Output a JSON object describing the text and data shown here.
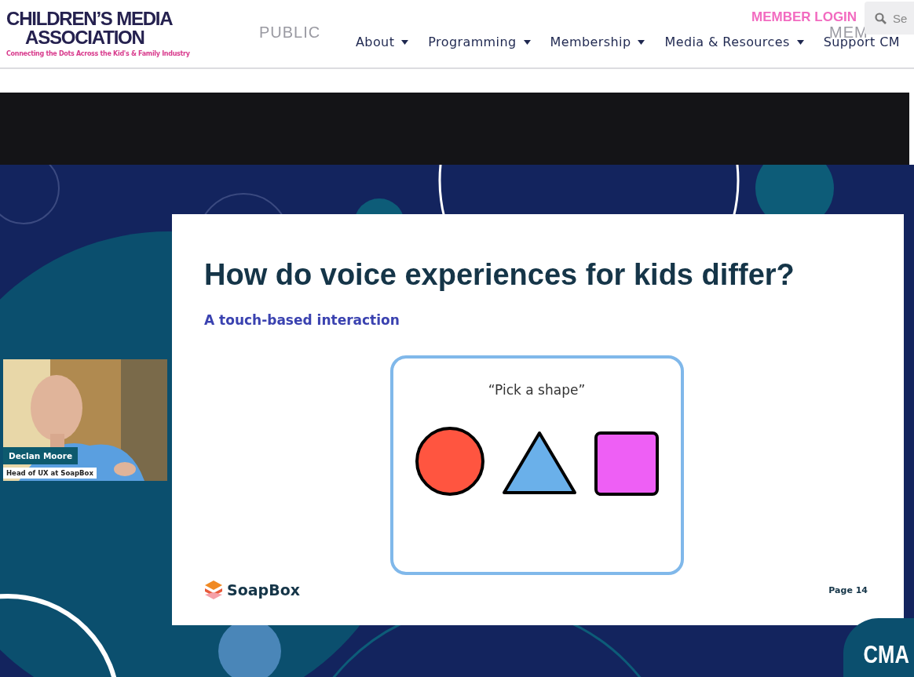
{
  "header": {
    "logo": {
      "line1": "CHILDREN’S MEDIA",
      "line2": "ASSOCIATION",
      "tagline": "Connecting the Dots Across the Kid's & Family Industry"
    },
    "faint_labels": [
      "PUBLIC",
      "MEM"
    ],
    "member_login": "MEMBER LOGIN",
    "search": {
      "placeholder": "Se"
    },
    "nav": [
      {
        "label": "About",
        "dropdown": true
      },
      {
        "label": "Programming",
        "dropdown": true
      },
      {
        "label": "Membership",
        "dropdown": true
      },
      {
        "label": "Media & Resources",
        "dropdown": true
      },
      {
        "label": "Support CM",
        "dropdown": false
      }
    ]
  },
  "video": {
    "speaker": {
      "name": "Declan Moore",
      "role": "Head of UX at SoapBox"
    },
    "slide": {
      "title": "How do voice experiences for kids differ?",
      "subtitle": "A touch-based interaction",
      "prompt": "“Pick a shape”",
      "shapes": [
        {
          "kind": "circle",
          "color": "#ff5540"
        },
        {
          "kind": "triangle",
          "color": "#6ab0ea"
        },
        {
          "kind": "square",
          "color": "#ee5ff5"
        }
      ],
      "brand": "SoapBox",
      "page": "Page 14"
    },
    "badge": "CMA"
  }
}
